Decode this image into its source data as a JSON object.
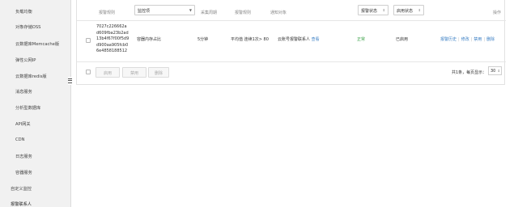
{
  "sidebar": {
    "items": [
      {
        "label": "负载均衡"
      },
      {
        "label": "对象存储OSS"
      },
      {
        "label": "云数据库Memcache版"
      },
      {
        "label": "弹性公网IP"
      },
      {
        "label": "云数据库redis版"
      },
      {
        "label": "消息服务"
      },
      {
        "label": "分析型数据库"
      },
      {
        "label": "API网关"
      },
      {
        "label": "CDN"
      },
      {
        "label": "日志服务"
      },
      {
        "label": "容器服务"
      },
      {
        "label": "自定义监控"
      },
      {
        "label": "报警联系人"
      }
    ]
  },
  "table": {
    "headers": {
      "rule_name": "报警规则",
      "metric_select": "监控项",
      "period": "采集周期",
      "rule": "报警规则",
      "notify": "通知对象",
      "status_select": "报警状态",
      "enabled_select": "启用状态",
      "actions": "操作"
    },
    "row": {
      "id_lines": [
        "7027c226662a",
        "d609fba23b2ad",
        "13b4f67f00f5d9",
        "d900aa905fcb0",
        "6e4858188512"
      ],
      "metric": "容器内存占比",
      "period": "5分钟",
      "rule": "平均值 连续1次> 80",
      "notify": "云账号报警联系人",
      "view": "查看",
      "status": "正常",
      "enabled": "已启用",
      "actions": [
        "报警历史",
        "修改",
        "禁用",
        "删除"
      ]
    }
  },
  "footer": {
    "buttons": [
      "启用",
      "禁用",
      "删除"
    ],
    "summary": "共1条，每页显示：",
    "page_size": "30"
  }
}
